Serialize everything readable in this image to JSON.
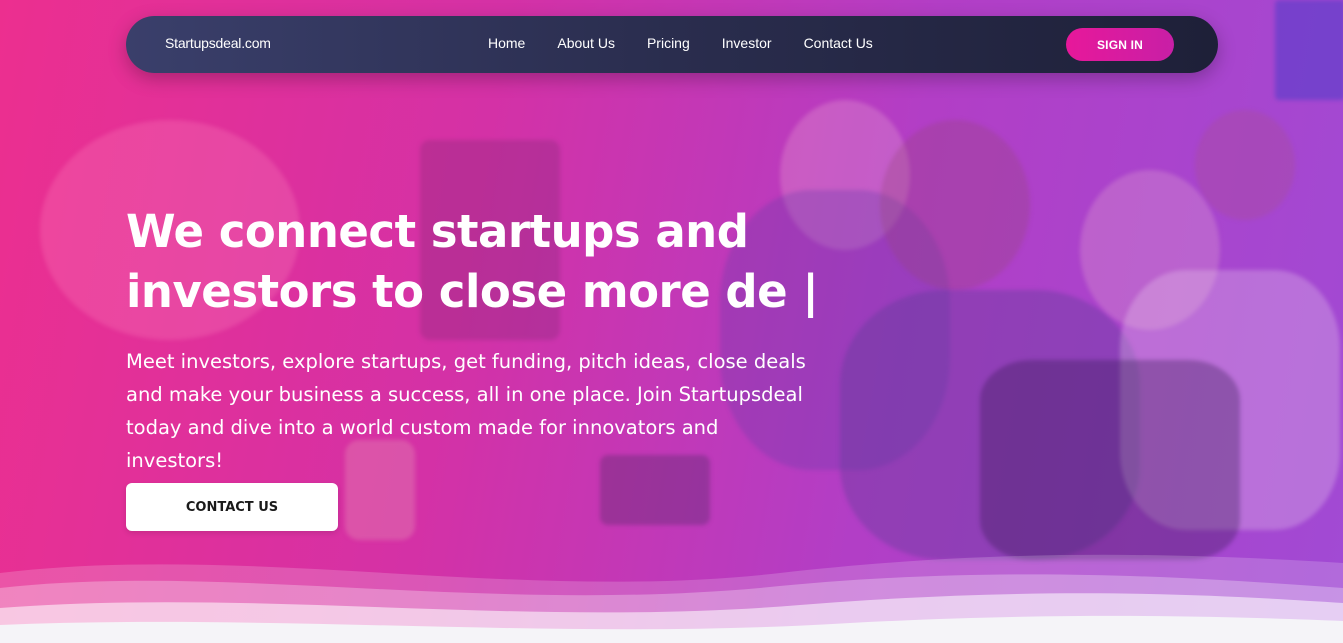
{
  "nav": {
    "brand": "Startupsdeal.com",
    "links": [
      "Home",
      "About Us",
      "Pricing",
      "Investor",
      "Contact Us"
    ],
    "signin_label": "SIGN IN"
  },
  "hero": {
    "headline_line1": "We connect startups and",
    "headline_line2": "investors to close more de |",
    "subtitle": "Meet investors, explore startups, get funding, pitch ideas, close deals and make your business a success, all in one place. Join Startupsdeal today and dive into a world custom made for innovators and investors!",
    "cta_label": "CONTACT US"
  },
  "colors": {
    "gradient_start": "#ec2f8f",
    "gradient_end": "#a14ad4",
    "navbar": "#2a2d4e",
    "signin_button": "#e7189a"
  }
}
